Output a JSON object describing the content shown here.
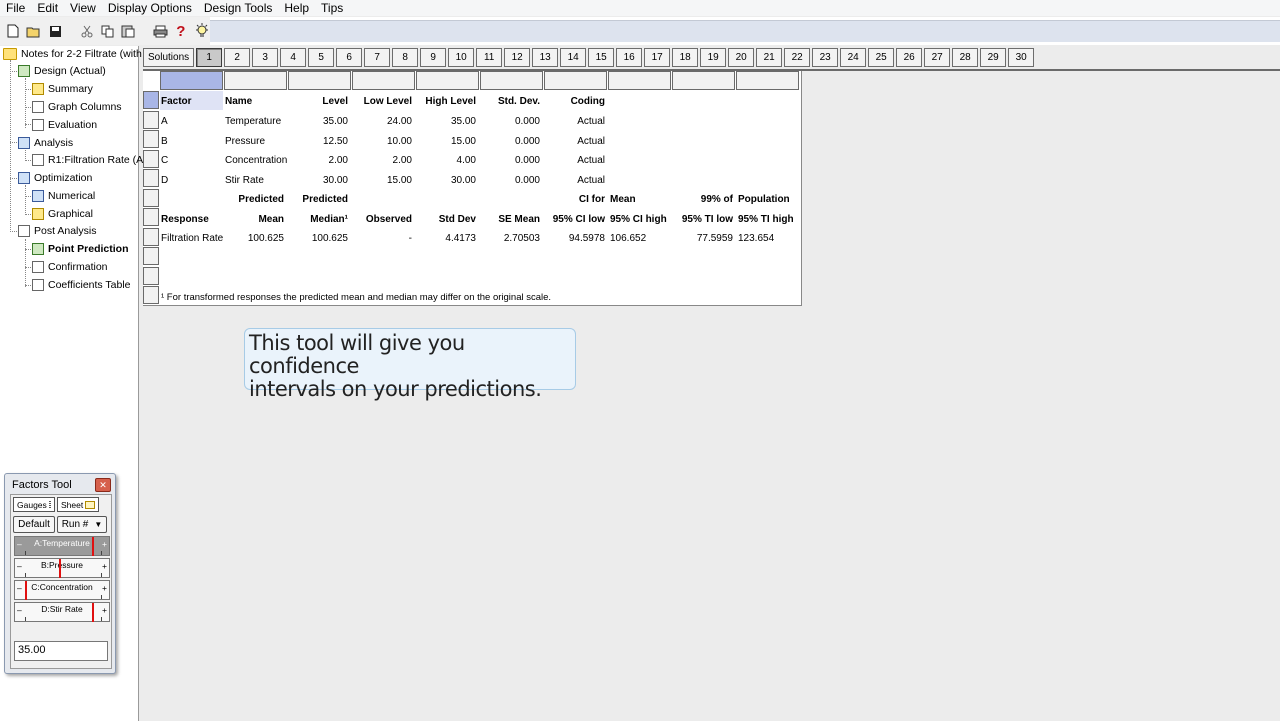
{
  "menu": [
    "File",
    "Edit",
    "View",
    "Display Options",
    "Design Tools",
    "Help",
    "Tips"
  ],
  "toolbar": {
    "icons": [
      "new-file-icon",
      "open-folder-icon",
      "save-icon",
      "cut-icon",
      "copy-icon",
      "paste-icon",
      "print-icon",
      "help-icon",
      "tip-bulb-icon"
    ],
    "help_glyph": "?"
  },
  "tree": {
    "root": "Notes for 2-2 Filtrate (with",
    "design": "Design (Actual)",
    "summary": "Summary",
    "graph_columns": "Graph Columns",
    "evaluation": "Evaluation",
    "analysis": "Analysis",
    "r1": "R1:Filtration Rate (A",
    "optimization": "Optimization",
    "numerical": "Numerical",
    "graphical": "Graphical",
    "post_analysis": "Post Analysis",
    "point_prediction": "Point Prediction",
    "confirmation": "Confirmation",
    "coefficients_table": "Coefficients Table"
  },
  "solutions": {
    "label": "Solutions",
    "tabs": [
      "1",
      "2",
      "3",
      "4",
      "5",
      "6",
      "7",
      "8",
      "9",
      "10",
      "11",
      "12",
      "13",
      "14",
      "15",
      "16",
      "17",
      "18",
      "19",
      "20",
      "21",
      "22",
      "23",
      "24",
      "25",
      "26",
      "27",
      "28",
      "29",
      "30"
    ],
    "active": "1"
  },
  "factor_table": {
    "headers": [
      "Factor",
      "Name",
      "Level",
      "Low Level",
      "High Level",
      "Std. Dev.",
      "Coding"
    ],
    "rows": [
      [
        "A",
        "Temperature",
        "35.00",
        "24.00",
        "35.00",
        "0.000",
        "Actual"
      ],
      [
        "B",
        "Pressure",
        "12.50",
        "10.00",
        "15.00",
        "0.000",
        "Actual"
      ],
      [
        "C",
        "Concentration",
        "2.00",
        "2.00",
        "4.00",
        "0.000",
        "Actual"
      ],
      [
        "D",
        "Stir Rate",
        "30.00",
        "15.00",
        "30.00",
        "0.000",
        "Actual"
      ]
    ]
  },
  "prediction_table": {
    "header1": {
      "pred1": "Predicted",
      "pred2": "Predicted",
      "ci_for": "CI for",
      "mean": "Mean",
      "pct99": "99% of",
      "population": "Population"
    },
    "header2": [
      "Response",
      "Mean",
      "Median¹",
      "Observed",
      "Std Dev",
      "SE Mean",
      "95% CI low",
      "95% CI high",
      "95% TI low",
      "95% TI high"
    ],
    "row": [
      "Filtration Rate",
      "100.625",
      "100.625",
      "-",
      "4.4173",
      "2.70503",
      "94.5978",
      "106.652",
      "77.5959",
      "123.654"
    ]
  },
  "footnote": "¹ For transformed responses the predicted mean and median may differ on the original scale.",
  "callout": {
    "line1": "This  tool will give you confidence",
    "line2": "intervals on your predictions."
  },
  "factors_tool": {
    "title": "Factors Tool",
    "close_glyph": "✕",
    "tab_gauges": "Gauges",
    "tab_sheet": "Sheet",
    "default_btn": "Default",
    "run_btn": "Run #",
    "gauges": [
      {
        "label": "A:Temperature",
        "level": 1.0
      },
      {
        "label": "B:Pressure",
        "level": 0.5
      },
      {
        "label": "C:Concentration",
        "level": 0.0
      },
      {
        "label": "D:Stir Rate",
        "level": 1.0
      }
    ],
    "minus": "–",
    "plus": "+",
    "value": "35.00"
  }
}
